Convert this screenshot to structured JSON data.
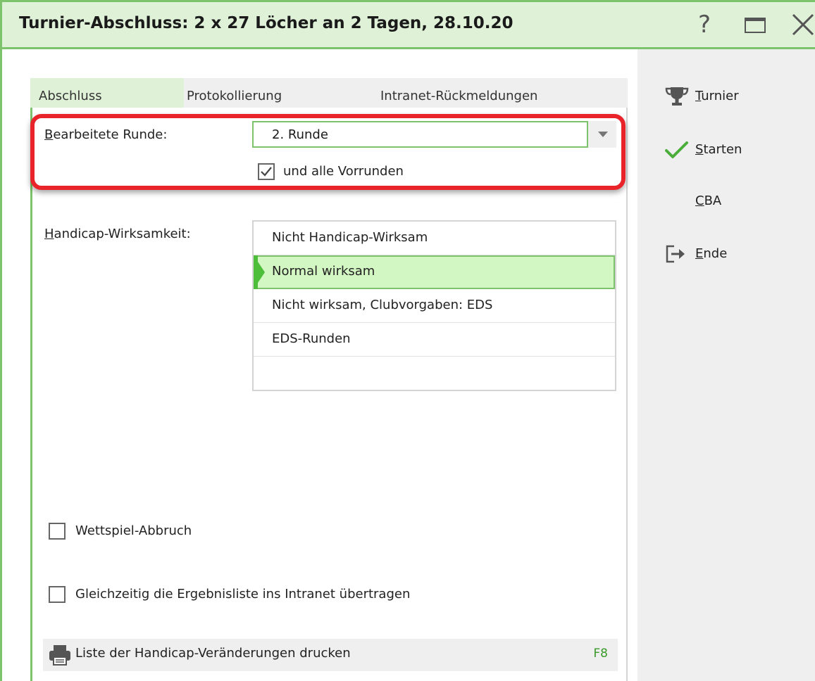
{
  "window": {
    "title": "Turnier-Abschluss: 2 x 27 Löcher an 2 Tagen, 28.10.20",
    "help_glyph": "?",
    "icons": [
      "help-icon",
      "maximize-icon",
      "close-icon"
    ]
  },
  "tabs": [
    {
      "label": "Abschluss",
      "active": true
    },
    {
      "label": "Protokollierung",
      "active": false
    },
    {
      "label": "Intranet-Rückmeldungen",
      "active": false
    }
  ],
  "round": {
    "label_first": "B",
    "label_rest": "earbeitete Runde:",
    "value": "2. Runde",
    "include_previous": {
      "label": "und alle Vorrunden",
      "checked": true
    }
  },
  "handicap": {
    "label_first": "H",
    "label_rest": "andicap-Wirksamkeit:",
    "options": [
      {
        "label": "Nicht Handicap-Wirksam",
        "selected": false
      },
      {
        "label": "Normal wirksam",
        "selected": true
      },
      {
        "label": "Nicht wirksam, Clubvorgaben: EDS",
        "selected": false
      },
      {
        "label": "EDS-Runden",
        "selected": false
      },
      {
        "label": "",
        "selected": false
      }
    ]
  },
  "options": {
    "abort": {
      "label": "Wettspiel-Abbruch",
      "checked": false
    },
    "intranet": {
      "label": "Gleichzeitig die Ergebnisliste ins Intranet übertragen",
      "checked": false
    }
  },
  "print": {
    "label": "Liste der Handicap-Veränderungen drucken",
    "shortcut": "F8",
    "icon": "printer-icon"
  },
  "actions": [
    {
      "first": "T",
      "rest": "urnier",
      "icon": "trophy-icon"
    },
    {
      "first": "S",
      "rest": "tarten",
      "icon": "checkmark-icon"
    },
    {
      "first": "C",
      "rest": "BA",
      "icon": ""
    },
    {
      "first": "E",
      "rest": "nde",
      "icon": "exit-icon"
    }
  ],
  "colors": {
    "accent_green": "#7cc36b",
    "selection_bg": "#d3f7c3",
    "highlight_red": "#e8242a"
  }
}
